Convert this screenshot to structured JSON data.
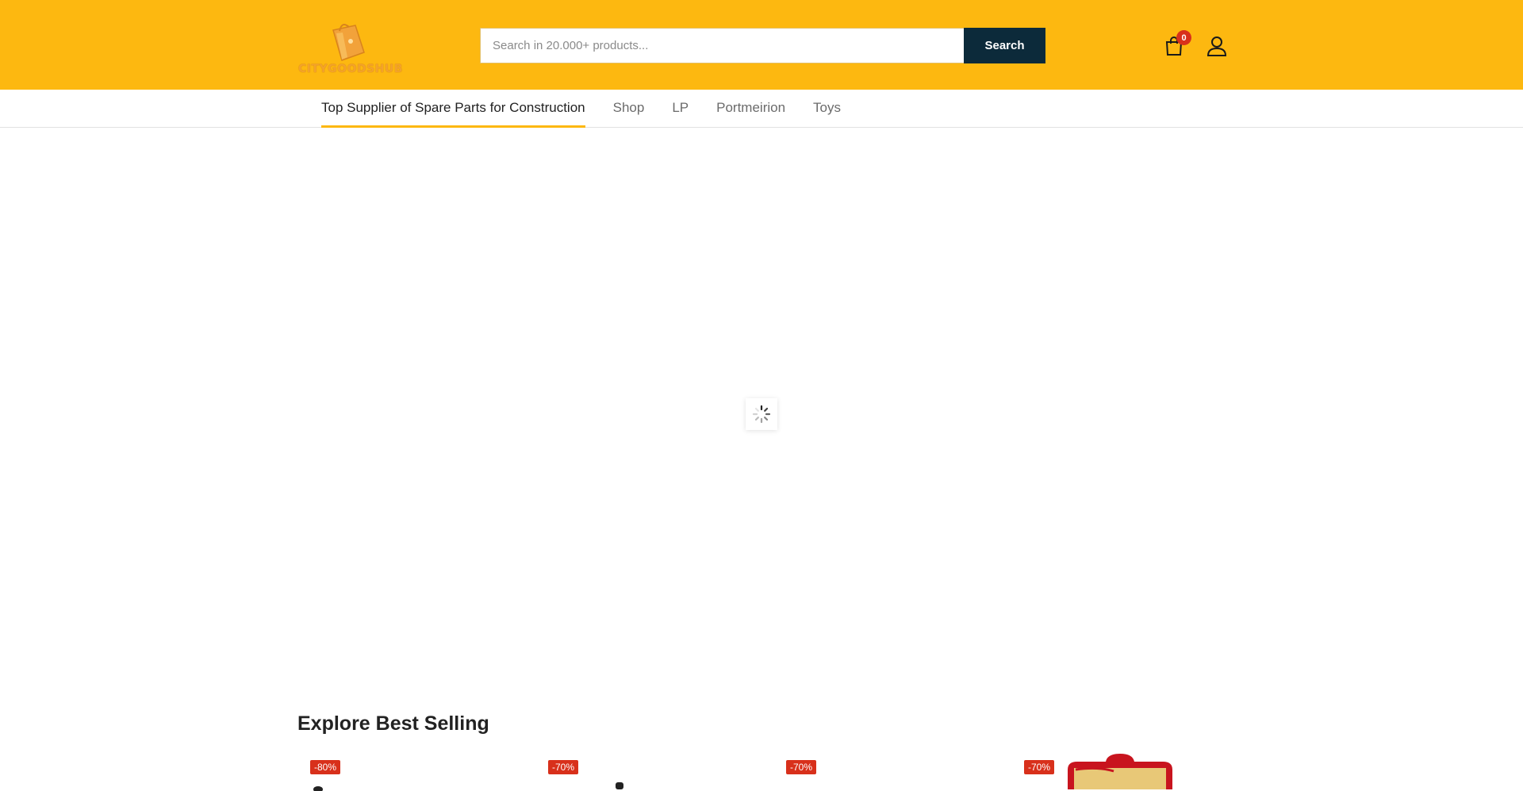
{
  "brand": {
    "name": "CITYGOODSHUB"
  },
  "search": {
    "placeholder": "Search in 20.000+ products...",
    "button_label": "Search"
  },
  "cart": {
    "count": "0"
  },
  "nav": {
    "items": [
      {
        "label": "Top Supplier of Spare Parts for Construction",
        "active": true
      },
      {
        "label": "Shop"
      },
      {
        "label": "LP"
      },
      {
        "label": "Portmeirion"
      },
      {
        "label": "Toys"
      }
    ]
  },
  "best_selling": {
    "title": "Explore Best Selling",
    "products": [
      {
        "discount": "-80%"
      },
      {
        "discount": "-70%"
      },
      {
        "discount": "-70%"
      },
      {
        "discount": "-70%"
      }
    ]
  },
  "colors": {
    "header_bg": "#FDB810",
    "search_button_bg": "#0c2a3a",
    "badge_red": "#d8301b"
  }
}
